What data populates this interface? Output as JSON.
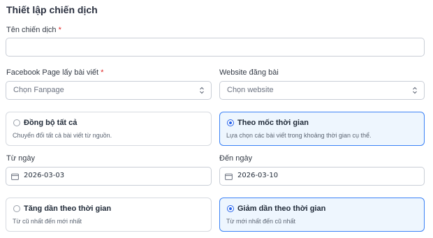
{
  "section_title": "Thiết lập chiến dịch",
  "campaign_name": {
    "label": "Tên chiến dịch",
    "required_mark": "*",
    "value": ""
  },
  "fanpage": {
    "label": "Facebook Page lấy bài viết",
    "required_mark": "*",
    "placeholder": "Chọn Fanpage"
  },
  "website": {
    "label": "Website đăng bài",
    "placeholder": "Chọn website"
  },
  "sync_mode": {
    "options": [
      {
        "title": "Đồng bộ tất cả",
        "desc": "Chuyển đổi tất cả bài viết từ nguồn.",
        "selected": false
      },
      {
        "title": "Theo mốc thời gian",
        "desc": "Lựa chọn các bài viết trong khoảng thời gian cụ thể.",
        "selected": true
      }
    ]
  },
  "from_date": {
    "label": "Từ ngày",
    "value": "2026-03-03"
  },
  "to_date": {
    "label": "Đến ngày",
    "value": "2026-03-10"
  },
  "order": {
    "options": [
      {
        "title": "Tăng dần theo thời gian",
        "desc": "Từ cũ nhất đến mới nhất",
        "selected": false
      },
      {
        "title": "Giảm dần theo thời gian",
        "desc": "Từ mới nhất đến cũ nhất",
        "selected": true
      }
    ]
  },
  "icons": {
    "select": "chevron-up-down-icon",
    "date": "calendar-icon"
  },
  "colors": {
    "accent": "#2563eb",
    "selected_bg": "#eef6fe",
    "required": "#e02424"
  }
}
